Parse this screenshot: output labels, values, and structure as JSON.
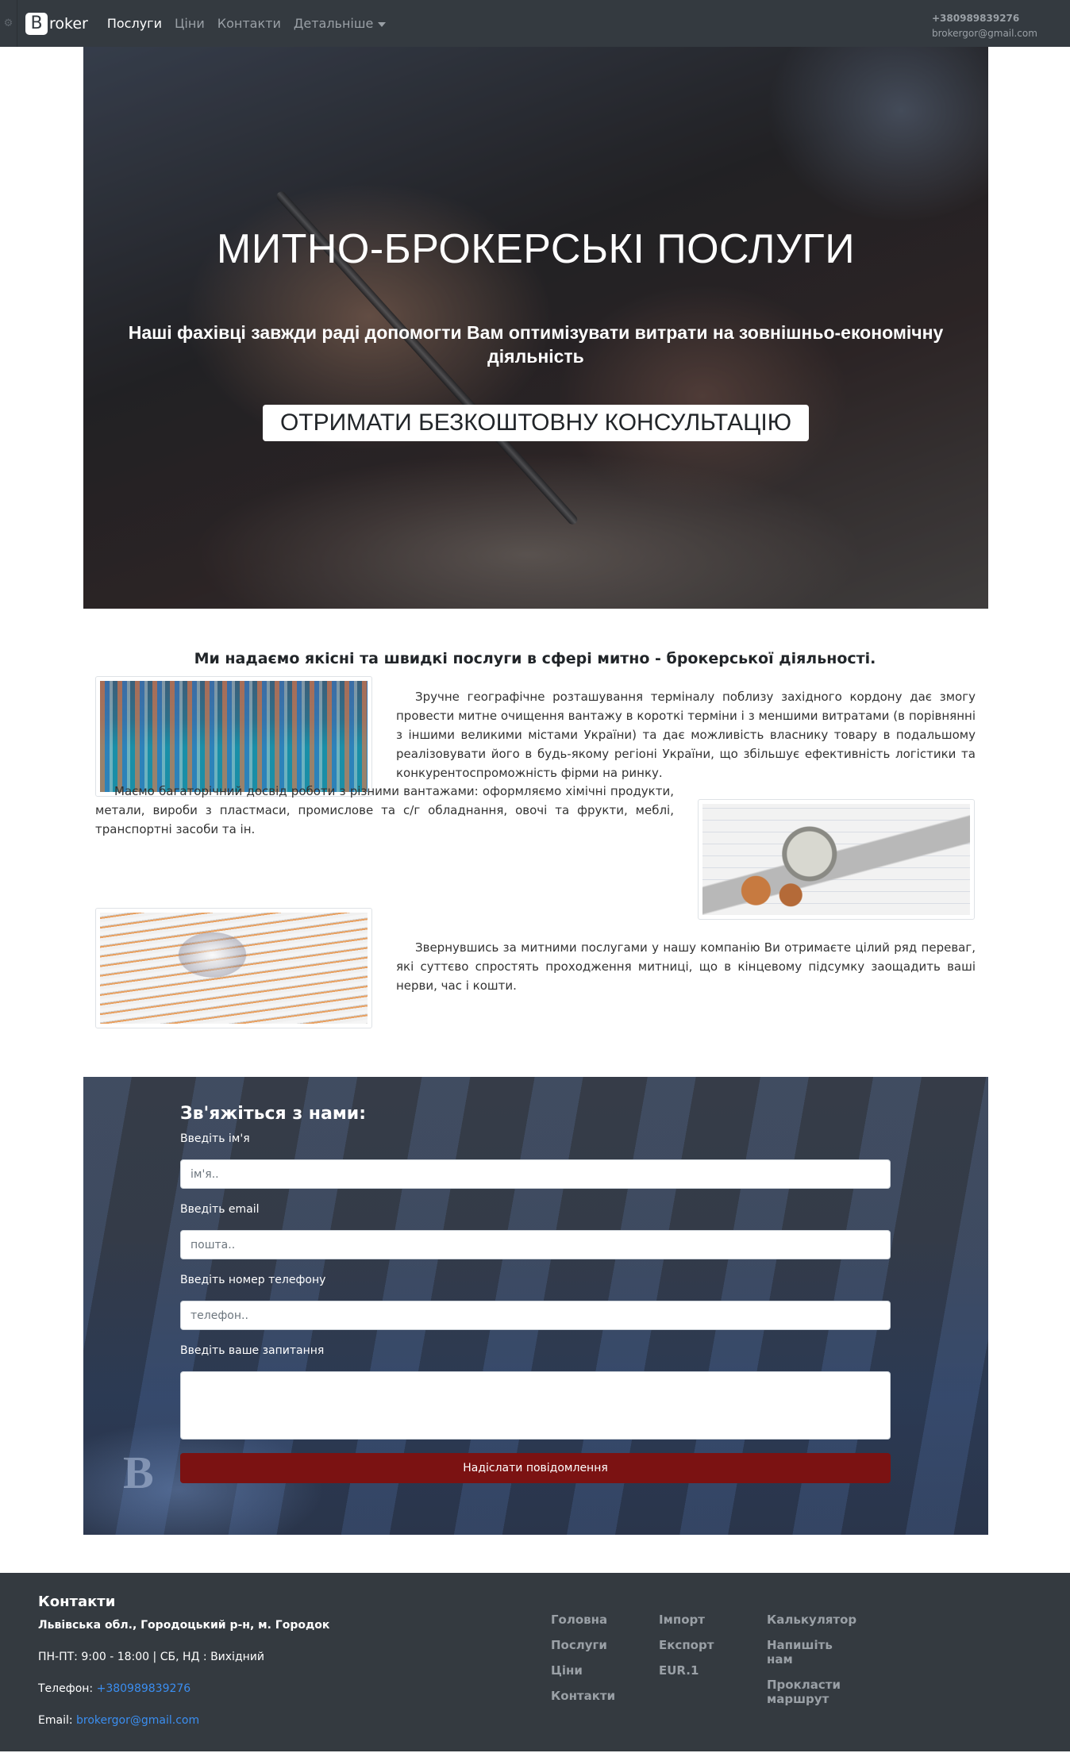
{
  "navbar": {
    "brand_letter": "B",
    "brand_text": "roker",
    "links": [
      "Послуги",
      "Ціни",
      "Контакти",
      "Детальніше"
    ],
    "phone": "+380989839276",
    "email": "brokergor@gmail.com"
  },
  "hero": {
    "title": "МИТНО-БРОКЕРСЬКІ ПОСЛУГИ",
    "subtitle": "Наші фахівці завжди раді допомогти Вам оптимізувати витрати на зовнішньо-економічну діяльність",
    "cta": "ОТРИМАТИ БЕЗКОШТОВНУ КОНСУЛЬТАЦІЮ"
  },
  "services": {
    "heading": "Ми надаємо якісні та швидкі послуги в сфері митно - брокерської діяльності.",
    "paragraphs": [
      "Зручне географічне розташування терміналу поблизу західного кордону дає змогу провести митне очищення вантажу в короткі терміни і з меншими витратами (в порівнянні з іншими великими містами України) та дає можливість власнику товару в подальшому реалізовувати його в будь-якому регіоні України, що збільшує ефективність логістики та конкурентоспроможність фірми на ринку.",
      "Маємо багаторічний досвід роботи з різними вантажами: оформляємо хімічні продукти, метали, вироби з пластмаси, промислове та с/г обладнання, овочі та фрукти, меблі, транспортні засоби та ін.",
      "Звернувшись за митними послугами у нашу компанію Ви отримаєте цілий ряд переваг, які суттєво спростять проходження митниці, що в кінцевому підсумку заощадить ваші нерви, час і кошти."
    ]
  },
  "contact_form": {
    "title": "Зв'яжіться з нами:",
    "name_label": "Введіть ім'я",
    "name_placeholder": "ім'я..",
    "email_label": "Введіть email",
    "email_placeholder": "пошта..",
    "phone_label": "Введіть номер телефону",
    "phone_placeholder": "телефон..",
    "question_label": "Введіть ваше запитання",
    "submit": "Надіслати повідомлення"
  },
  "footer": {
    "title": "Контакти",
    "address": "Львівська обл., Городоцький р-н, м. Городок",
    "hours": "ПН-ПТ: 9:00 - 18:00 | СБ, НД : Вихідний",
    "phone_label": "Телефон: ",
    "phone": "+380989839276",
    "email_label": "Email: ",
    "email": "brokergor@gmail.com",
    "col1": [
      "Головна",
      "Послуги",
      "Ціни",
      "Контакти"
    ],
    "col2": [
      "Імпорт",
      "Експорт",
      "EUR.1"
    ],
    "col3": [
      "Калькулятор",
      "Напишіть нам",
      "Прокласти маршрут"
    ]
  }
}
